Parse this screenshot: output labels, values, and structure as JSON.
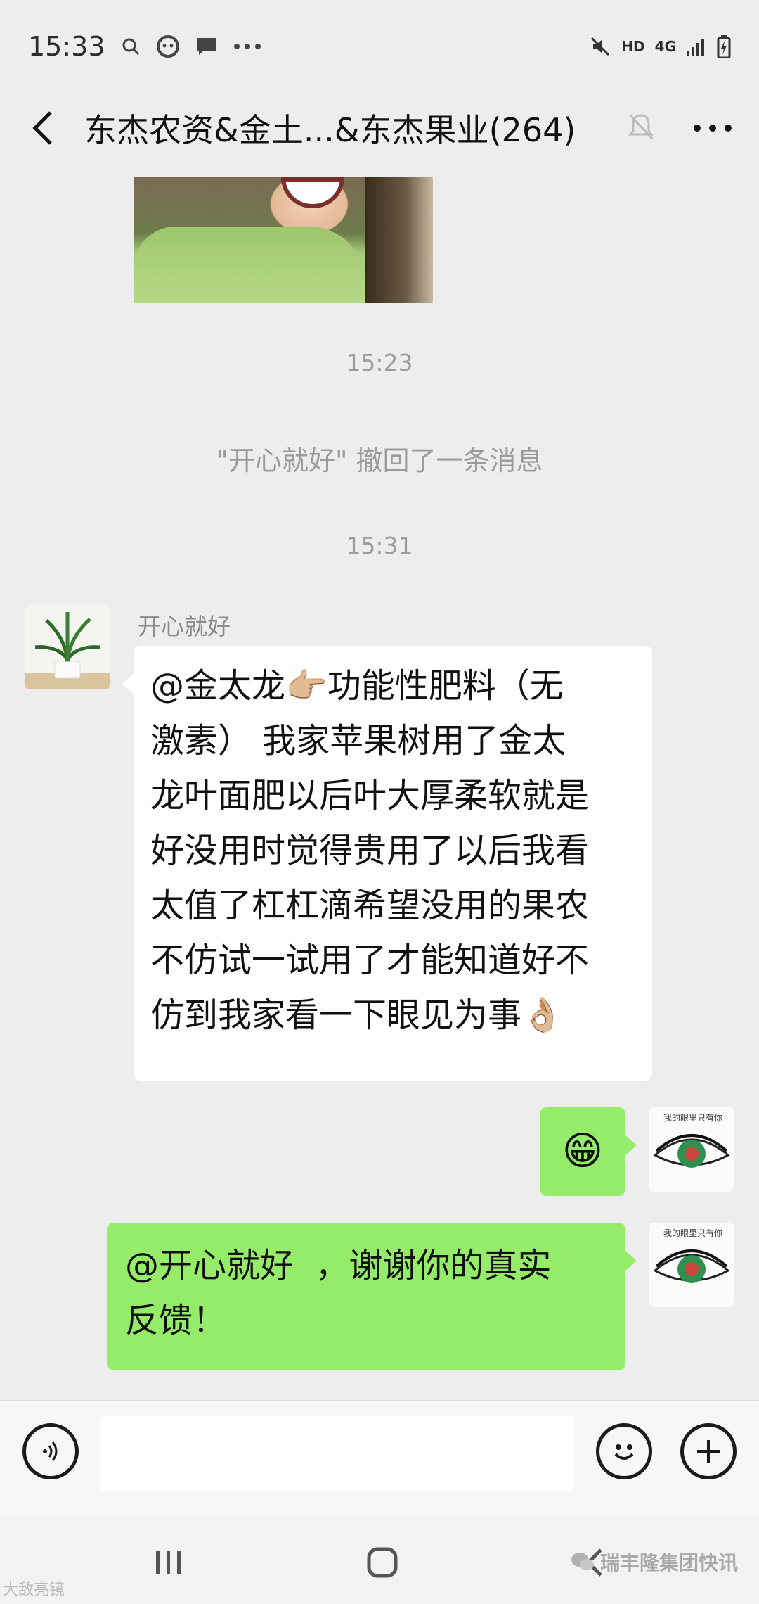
{
  "status_bar": {
    "time": "15:33",
    "network_label": "HD",
    "signal_label": "4G"
  },
  "header": {
    "title": "东杰农资&金土...&东杰果业(264)"
  },
  "chat": {
    "time_1": "15:23",
    "recall_notice": "\"开心就好\" 撤回了一条消息",
    "time_2": "15:31",
    "sender_name": "开心就好",
    "message_1_line_1": "@金太龙👉🏼功能性肥料（无",
    "message_1_line_2": "激素） 我家苹果树用了金太",
    "message_1_line_3": "龙叶面肥以后叶大厚柔软就是",
    "message_1_line_4": "好没用时觉得贵用了以后我看",
    "message_1_line_5": "太值了杠杠滴希望没用的果农",
    "message_1_line_6": "不仿试一试用了才能知道好不",
    "message_1_line_7": "仿到我家看一下眼见为事👌🏼",
    "reply_emoji": "😁",
    "reply_line_1": "@开心就好  ，谢谢你的真实",
    "reply_line_2": "反馈！",
    "avatar_caption": "我的眼里只有你"
  },
  "input_bar": {
    "placeholder": ""
  },
  "watermarks": {
    "left": "大敌亮镜",
    "right": "瑞丰隆集团快讯"
  },
  "colors": {
    "background": "#ededed",
    "own_bubble": "#95ec69",
    "other_bubble": "#ffffff"
  }
}
